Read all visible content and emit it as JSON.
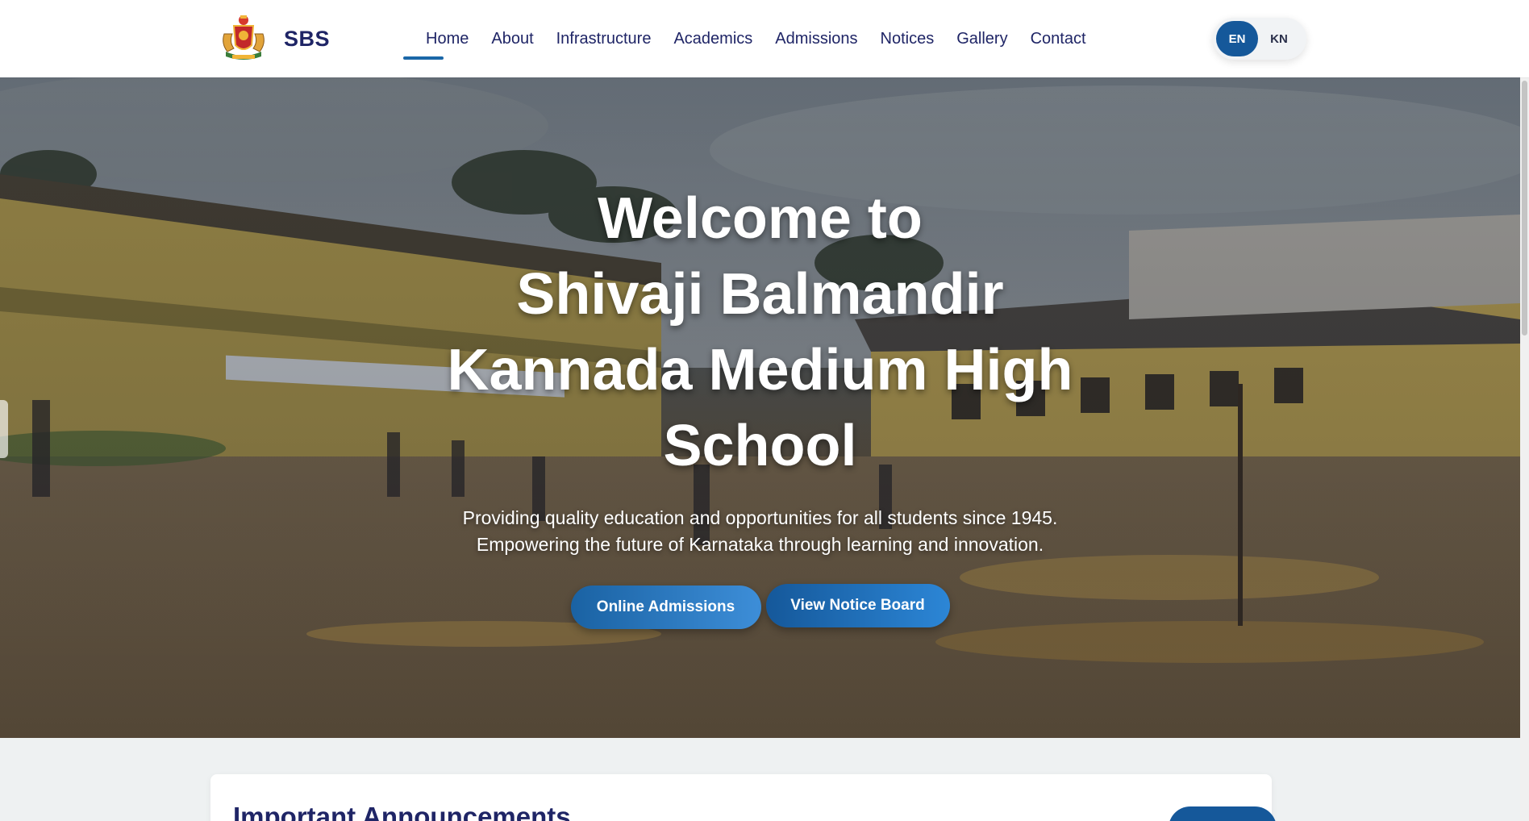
{
  "header": {
    "brand_name": "SBS",
    "nav": [
      {
        "label": "Home",
        "active": true
      },
      {
        "label": "About"
      },
      {
        "label": "Infrastructure"
      },
      {
        "label": "Academics"
      },
      {
        "label": "Admissions"
      },
      {
        "label": "Notices"
      },
      {
        "label": "Gallery"
      },
      {
        "label": "Contact"
      }
    ],
    "languages": [
      {
        "label": "EN",
        "active": true
      },
      {
        "label": "KN"
      }
    ]
  },
  "hero": {
    "title_line1": "Welcome to",
    "title_line2": "Shivaji Balmandir",
    "title_line3": "Kannada Medium High",
    "title_line4": "School",
    "subtitle_line1": "Providing quality education and opportunities for all students since 1945.",
    "subtitle_line2": "Empowering the future of Karnataka through learning and innovation.",
    "primary_button": "Online Admissions",
    "secondary_button": "View Notice Board"
  },
  "announcements": {
    "title": "Important Announcements"
  },
  "colors": {
    "brand_navy": "#1f2566",
    "accent_blue": "#15589a",
    "accent_blue_light": "#3d8ed8",
    "page_background": "#eef1f2"
  },
  "icons": {
    "logo": "karnataka-emblem-icon"
  }
}
